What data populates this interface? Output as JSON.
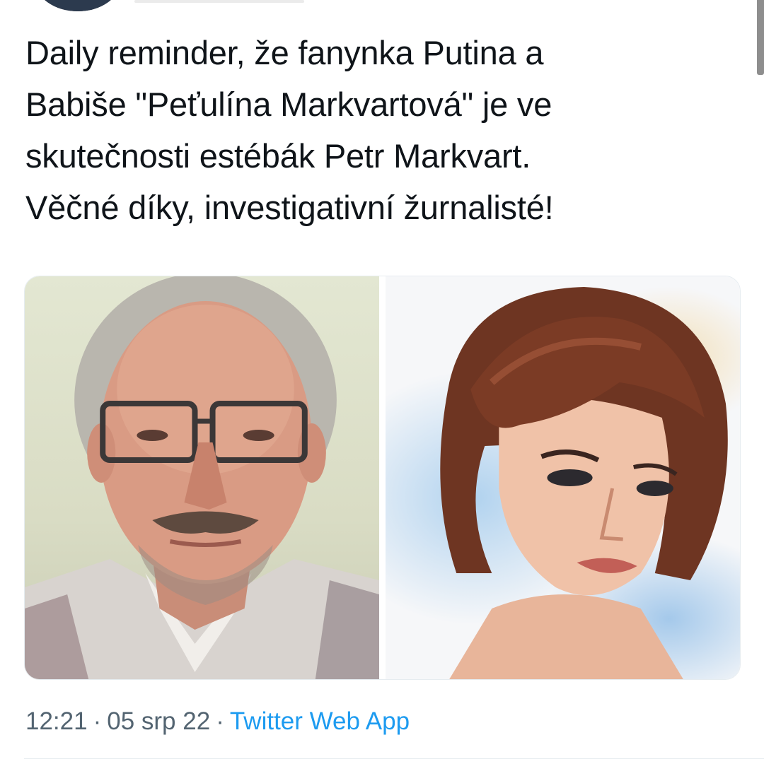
{
  "tweet": {
    "text_lines": [
      "Daily reminder, že fanynka Putina a",
      "Babiše \"Peťulína Markvartová\" je ve",
      "skutečnosti estébák Petr Markvart.",
      "Věčné díky, investigativní žurnalisté!"
    ],
    "time": "12:21",
    "date": "05 srp 22",
    "source": "Twitter Web App",
    "separator": "·"
  },
  "media": {
    "photos": [
      {
        "icon": "portrait-photo-man-glasses-mustache"
      },
      {
        "icon": "illustration-woman-short-brown-hair"
      }
    ]
  },
  "colors": {
    "text": "#0f1419",
    "meta": "#536471",
    "link": "#1d9bf0",
    "divider": "#e6ecf0"
  }
}
